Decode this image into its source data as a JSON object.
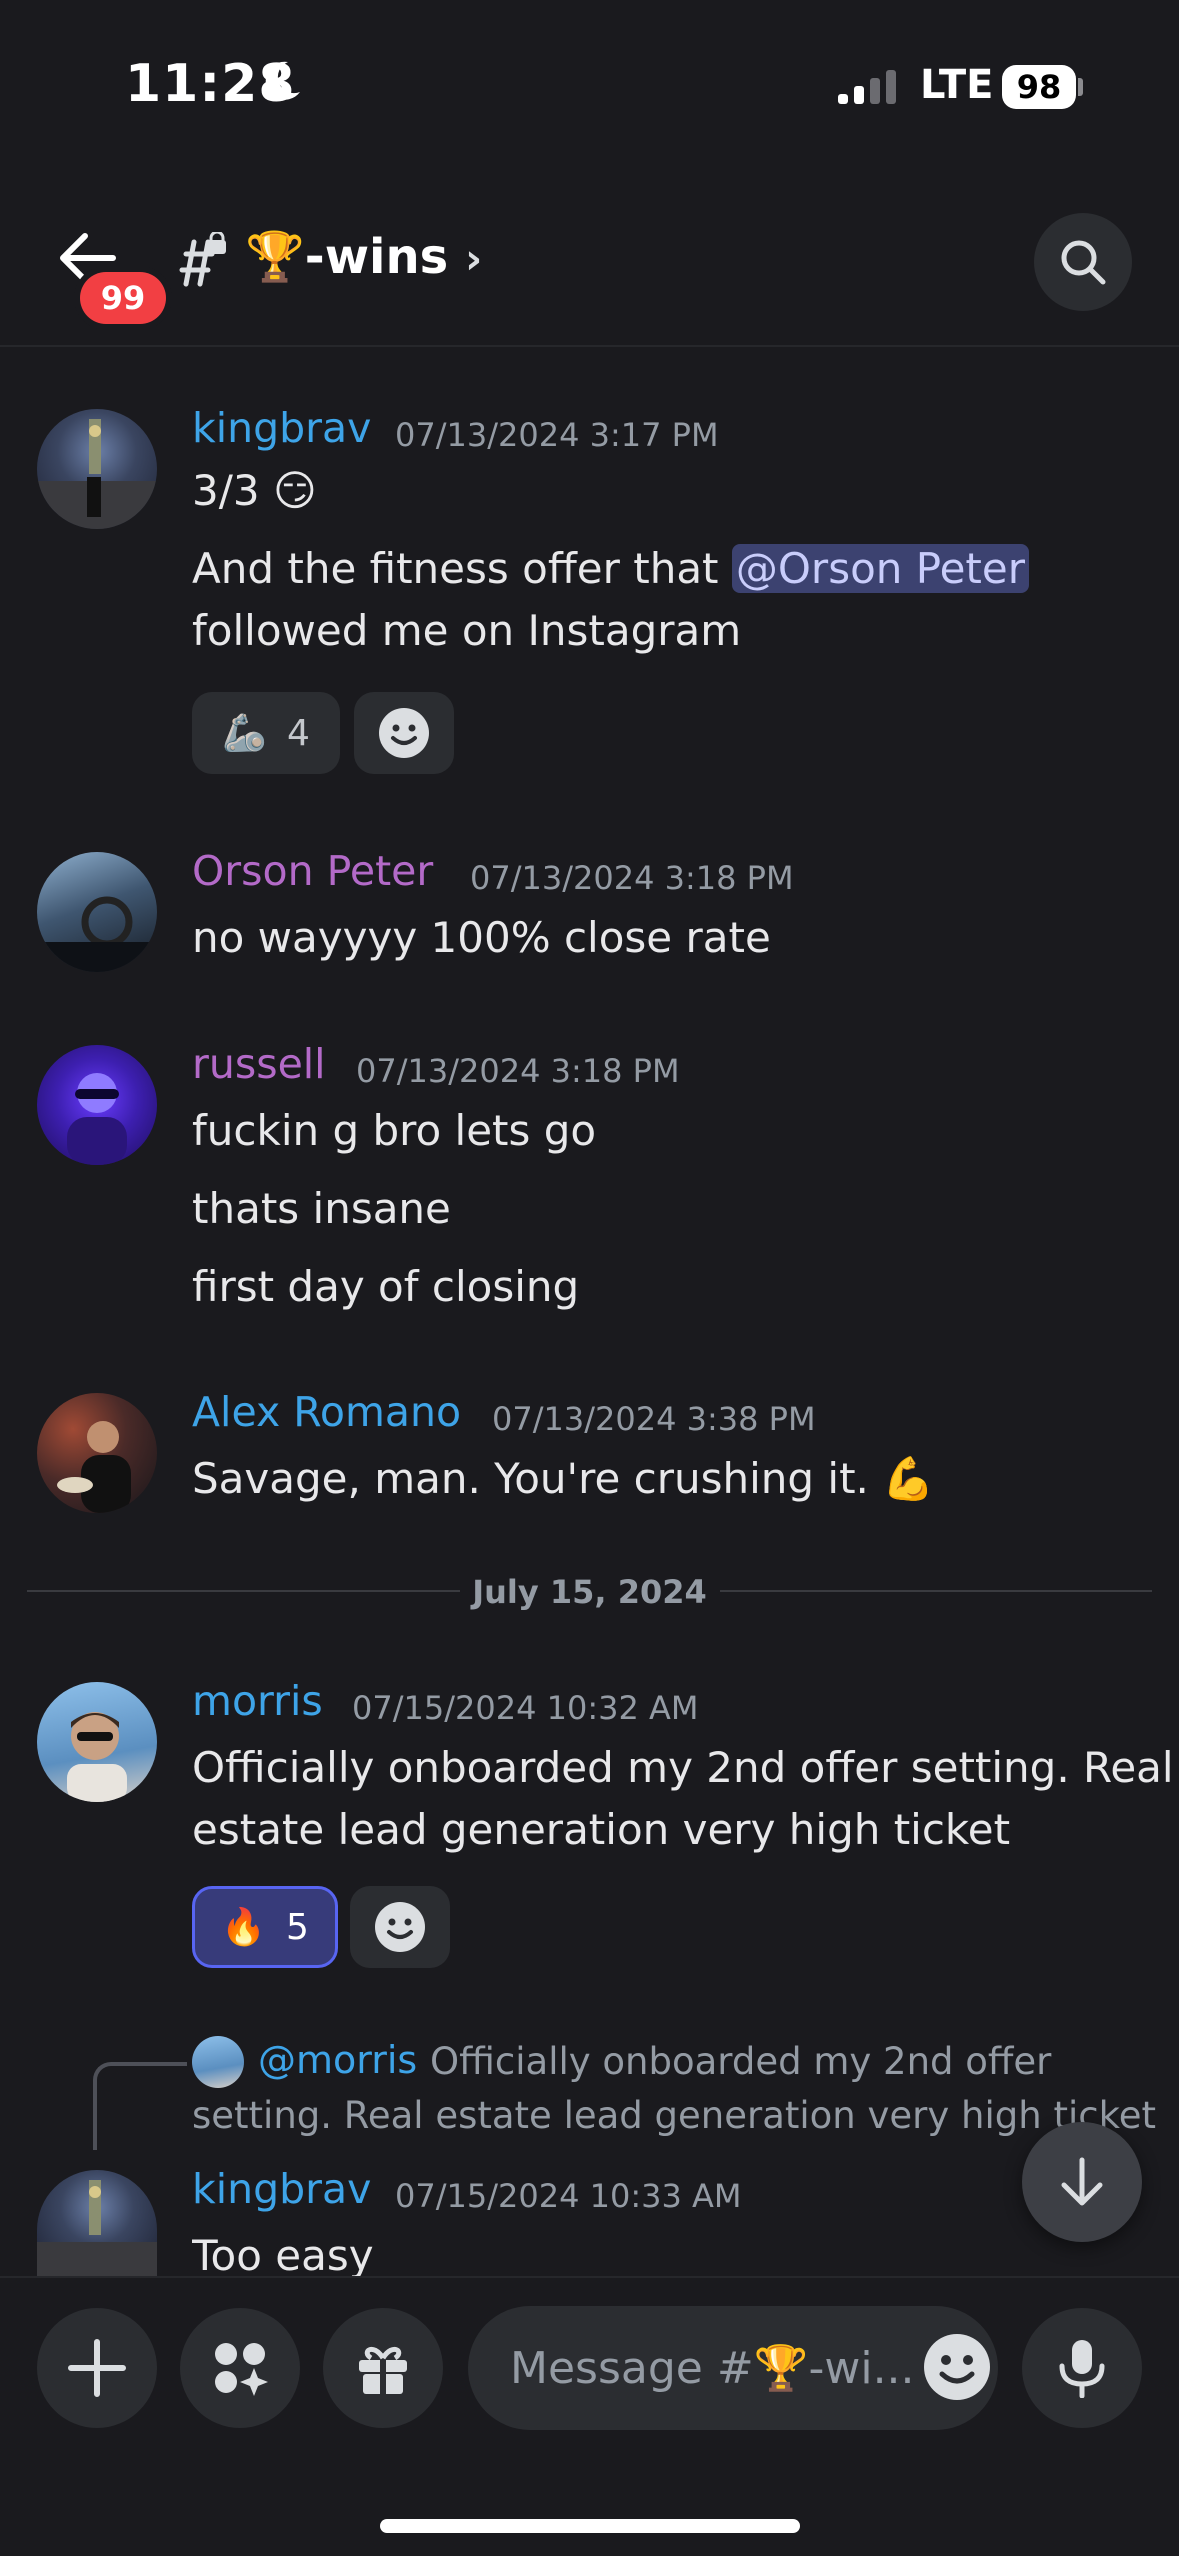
{
  "status_bar": {
    "time": "11:28",
    "network": "LTE",
    "battery": "98"
  },
  "header": {
    "unread_badge": "99",
    "channel_name": "🏆-wins",
    "chevron": "›"
  },
  "messages": [
    {
      "user": "kingbrav",
      "timestamp": "07/13/2024 3:17 PM",
      "lines": [
        "3/3 😏"
      ],
      "line2_pre": "And the fitness offer that ",
      "line2_mention": "@Orson Peter",
      "line3": "followed me on Instagram",
      "reaction": {
        "emoji": "🦾",
        "count": "4"
      }
    },
    {
      "user": "Orson Peter",
      "timestamp": "07/13/2024 3:18 PM",
      "lines": [
        "no wayyyy 100% close rate"
      ]
    },
    {
      "user": "russell",
      "timestamp": "07/13/2024 3:18 PM",
      "lines": [
        "fuckin g bro lets go",
        "thats insane",
        "first day of closing"
      ]
    },
    {
      "user": "Alex Romano",
      "timestamp": "07/13/2024 3:38 PM",
      "lines": [
        "Savage, man. You're crushing it. 💪"
      ]
    },
    {
      "user": "morris",
      "timestamp": "07/15/2024 10:32 AM",
      "lines": [
        "Officially onboarded my 2nd offer setting. Real",
        "estate lead generation very high ticket"
      ],
      "reaction": {
        "emoji": "🔥",
        "count": "5"
      }
    },
    {
      "user": "kingbrav",
      "timestamp": "07/15/2024 10:33 AM",
      "lines": [
        "Too easy"
      ],
      "reply": {
        "user": "@morris",
        "text_line1": "Officially onboarded my 2nd offer",
        "text_line2": "setting. Real estate lead generation very high ticket"
      }
    }
  ],
  "date_separator": "July 15, 2024",
  "composer": {
    "placeholder": "Message #🏆-wi..."
  },
  "colors": {
    "background": "#1a1a1e",
    "username_blue": "#3ea4e8",
    "username_purple": "#b36ac8",
    "mention_bg": "#3c4270",
    "badge_red": "#f23f43"
  }
}
